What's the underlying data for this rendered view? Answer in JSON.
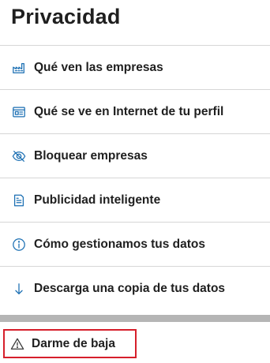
{
  "page": {
    "title": "Privacidad"
  },
  "menu": {
    "items": [
      {
        "label": "Qué ven las empresas",
        "icon": "factory-icon"
      },
      {
        "label": "Qué se ve en Internet de tu perfil",
        "icon": "browser-window-icon"
      },
      {
        "label": "Bloquear empresas",
        "icon": "eye-slash-icon"
      },
      {
        "label": "Publicidad inteligente",
        "icon": "document-list-icon"
      },
      {
        "label": "Cómo gestionamos tus datos",
        "icon": "info-icon"
      },
      {
        "label": "Descarga una copia de tus datos",
        "icon": "arrow-down-icon"
      }
    ]
  },
  "logout": {
    "label": "Darme de baja",
    "icon": "warning-triangle-icon"
  },
  "colors": {
    "icon_accent": "#1b6fb3",
    "highlight_border": "#d61f2b",
    "separator": "#b5b5b5",
    "divider": "#d6d6d6"
  }
}
